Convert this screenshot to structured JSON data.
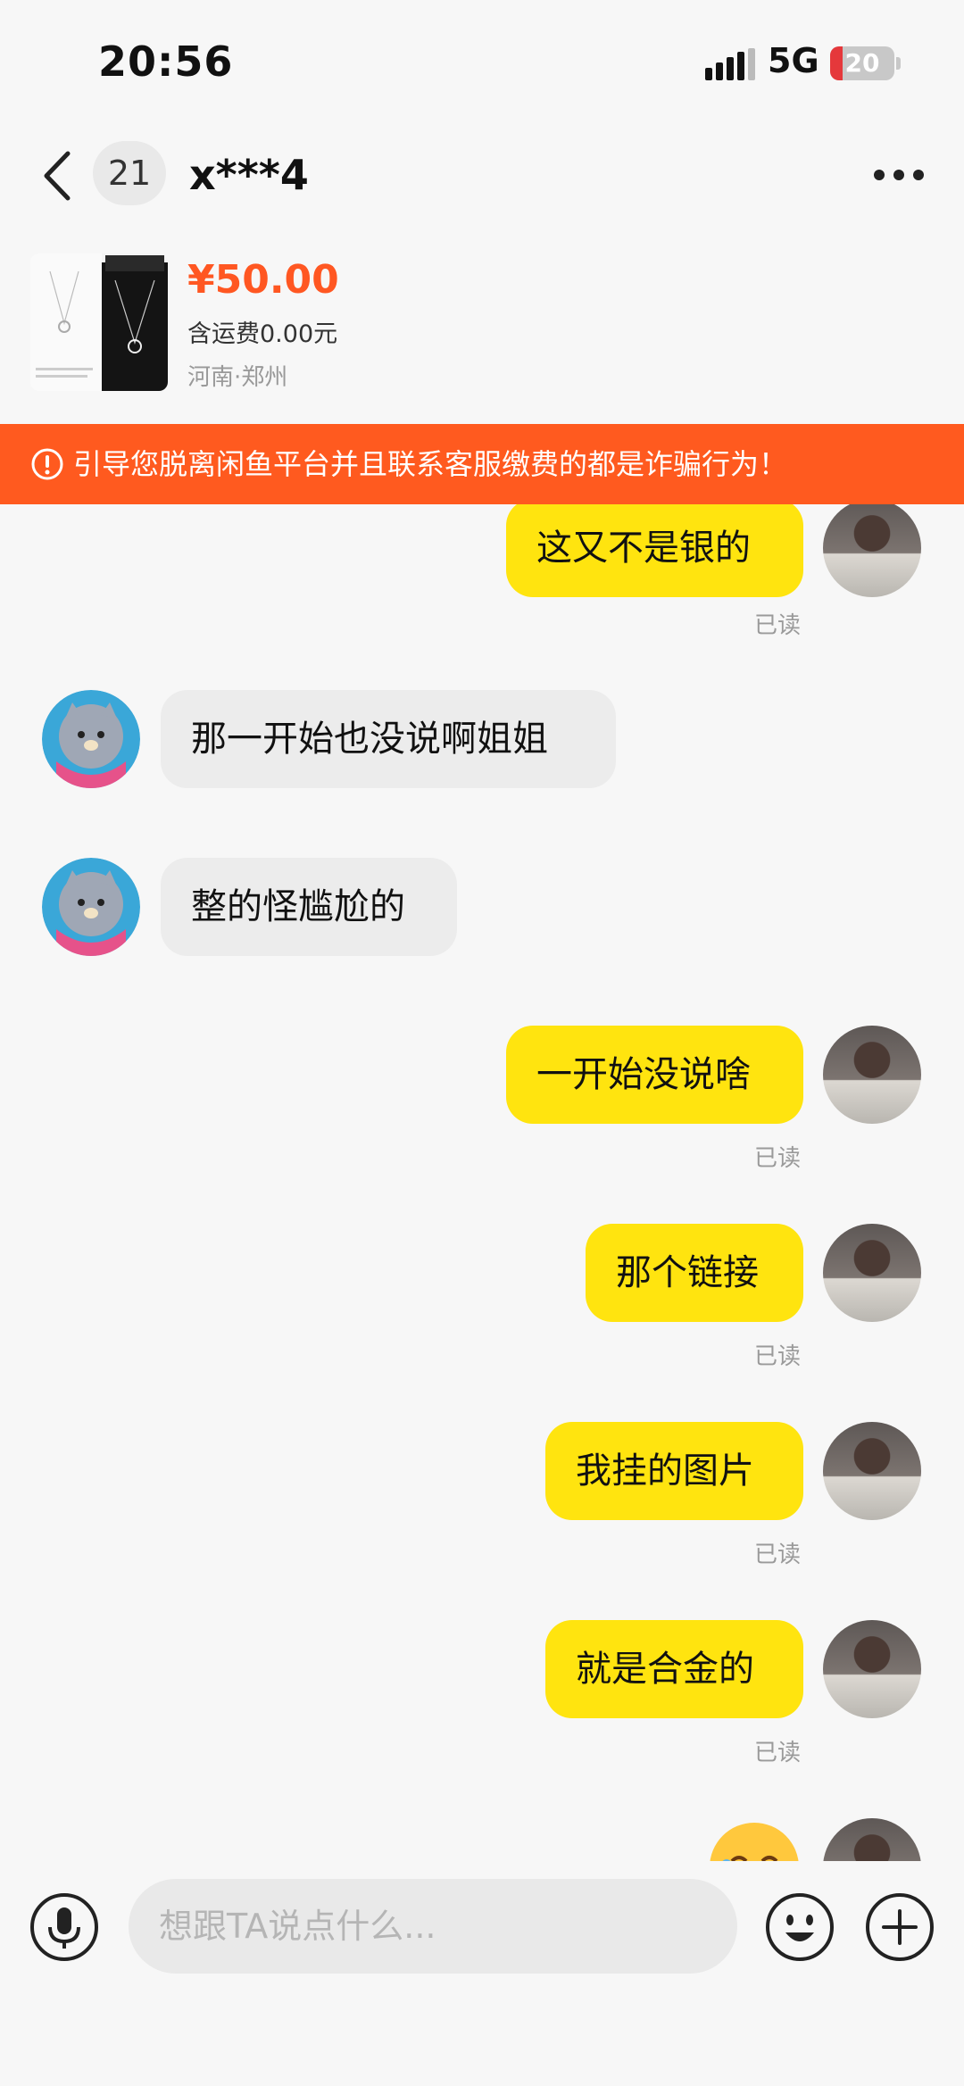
{
  "status_bar": {
    "time": "20:56",
    "network": "5G",
    "battery": "20",
    "battery_level": 0.2
  },
  "nav": {
    "unread_count": "21",
    "title": "x***4"
  },
  "product": {
    "price": "¥50.00",
    "shipping": "含运费0.00元",
    "location": "河南·郑州"
  },
  "warning": {
    "text": "引导您脱离闲鱼平台并且联系客服缴费的都是诈骗行为！"
  },
  "messages": [
    {
      "side": "out",
      "text": "这又不是银的",
      "status": "已读"
    },
    {
      "side": "in",
      "text": "那一开始也没说啊姐姐"
    },
    {
      "side": "in",
      "text": "整的怪尴尬的"
    },
    {
      "side": "out",
      "text": "一开始没说啥",
      "status": "已读"
    },
    {
      "side": "out",
      "text": "那个链接",
      "status": "已读"
    },
    {
      "side": "out",
      "text": "我挂的图片",
      "status": "已读"
    },
    {
      "side": "out",
      "text": "就是合金的",
      "status": "已读"
    }
  ],
  "input": {
    "placeholder": "想跟TA说点什么..."
  },
  "colors": {
    "accent": "#ff5a1f",
    "price": "#ff5722",
    "bubble_out": "#ffe40f",
    "bubble_in": "#ececec"
  }
}
